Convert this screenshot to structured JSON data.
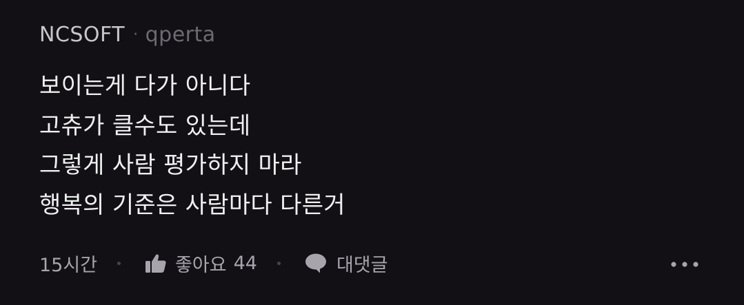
{
  "comment": {
    "company": "NCSOFT",
    "separator": "·",
    "handle": "qperta",
    "lines": [
      "보이는게 다가 아니다",
      "고츄가 클수도 있는데",
      "그렇게 사람 평가하지 마라",
      "행복의 기준은 사람마다 다른거"
    ],
    "timestamp": "15시간",
    "like_label": "좋아요",
    "like_count": "44",
    "reply_label": "대댓글"
  },
  "icons": {
    "like": "thumbs-up-icon",
    "reply": "speech-bubble-icon",
    "more": "more-horizontal-icon"
  },
  "colors": {
    "background": "#121014",
    "text": "#efeff1",
    "muted": "#a6a5ab",
    "handle": "#6c6b72"
  }
}
